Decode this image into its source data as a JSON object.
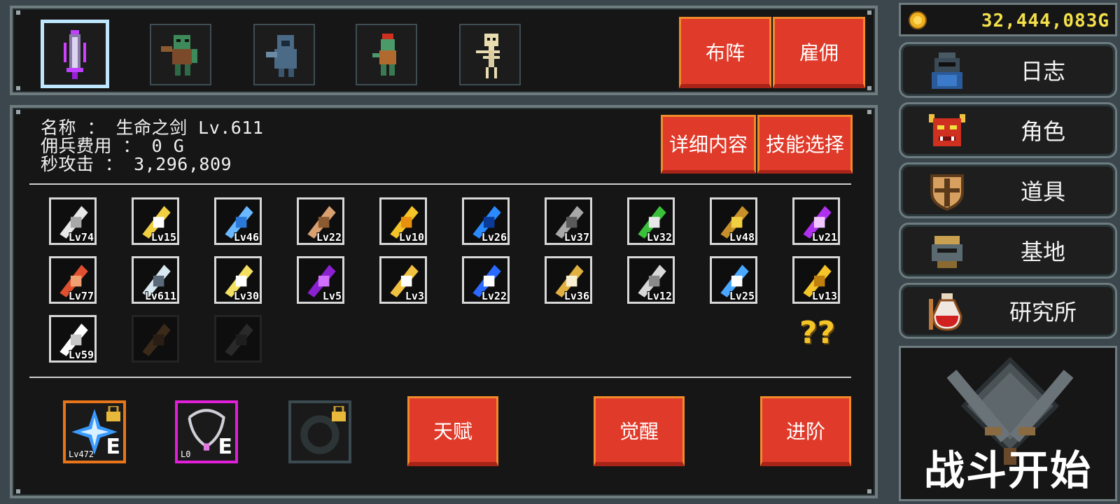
{
  "top_bar": {
    "formation_label": "布阵",
    "hire_label": "雇佣"
  },
  "unit_info": {
    "name_line": "名称 ： 生命之剑 Lv.611",
    "cost_line": "佣兵费用 ： 0 G",
    "dps_line": "秒攻击 ： 3,296,809",
    "details_label": "详细内容",
    "skill_select_label": "技能选择"
  },
  "skills": [
    {
      "lv": "Lv74",
      "icon": "shield-icon"
    },
    {
      "lv": "Lv15",
      "icon": "frame-icon"
    },
    {
      "lv": "Lv46",
      "icon": "lightning-icon"
    },
    {
      "lv": "Lv22",
      "icon": "claw-icon"
    },
    {
      "lv": "Lv10",
      "icon": "yellow-arrows-icon"
    },
    {
      "lv": "Lv26",
      "icon": "blue-slash-icon"
    },
    {
      "lv": "Lv37",
      "icon": "axe-icon"
    },
    {
      "lv": "Lv32",
      "icon": "leaf-blade-icon"
    },
    {
      "lv": "Lv48",
      "icon": "crossbow-icon"
    },
    {
      "lv": "Lv21",
      "icon": "purple-burst-icon"
    },
    {
      "lv": "Lv77",
      "icon": "fire-flower-icon"
    },
    {
      "lv": "Lv611",
      "icon": "shuriken-icon"
    },
    {
      "lv": "Lv30",
      "icon": "stars-icon"
    },
    {
      "lv": "Lv5",
      "icon": "purple-slash-icon"
    },
    {
      "lv": "Lv3",
      "icon": "chalice-icon"
    },
    {
      "lv": "Lv22",
      "icon": "blue-flame-icon"
    },
    {
      "lv": "Lv36",
      "icon": "golden-sword-icon"
    },
    {
      "lv": "Lv12",
      "icon": "armor-icon"
    },
    {
      "lv": "Lv25",
      "icon": "ice-claw-icon"
    },
    {
      "lv": "Lv13",
      "icon": "up-arrow-icon"
    },
    {
      "lv": "Lv59",
      "icon": "ring-icon"
    },
    {
      "lv": "",
      "icon": "locked-crossbow-icon"
    },
    {
      "lv": "",
      "icon": "locked-spear-icon"
    }
  ],
  "unknown_glyph": "??",
  "equipment": [
    {
      "lv": "Lv472",
      "grade": "E",
      "icon": "star-crystal-icon",
      "locked": true,
      "frame": "#e8751a"
    },
    {
      "lv": "L0",
      "grade": "E",
      "icon": "necklace-icon",
      "locked": false,
      "frame": "#e020d8"
    },
    {
      "lv": "",
      "grade": "",
      "icon": "empty-ring-slot-icon",
      "locked": true,
      "frame": "#3a4a50"
    }
  ],
  "bottom_buttons": {
    "talent": "天赋",
    "awaken": "觉醒",
    "advance": "进阶"
  },
  "gold": "32,444,083G",
  "menu": [
    {
      "label": "日志",
      "icon": "journal-knight-icon"
    },
    {
      "label": "角色",
      "icon": "demon-mask-icon"
    },
    {
      "label": "道具",
      "icon": "shield-emblem-icon"
    },
    {
      "label": "基地",
      "icon": "helmet-fortress-icon"
    },
    {
      "label": "研究所",
      "icon": "potion-icon"
    }
  ],
  "battle_label": "战斗开始",
  "colors": {
    "button_red": "#e03b2a",
    "button_border": "#f08a2a",
    "gold_text": "#f4e04a",
    "panel_border": "#6e7c80"
  }
}
